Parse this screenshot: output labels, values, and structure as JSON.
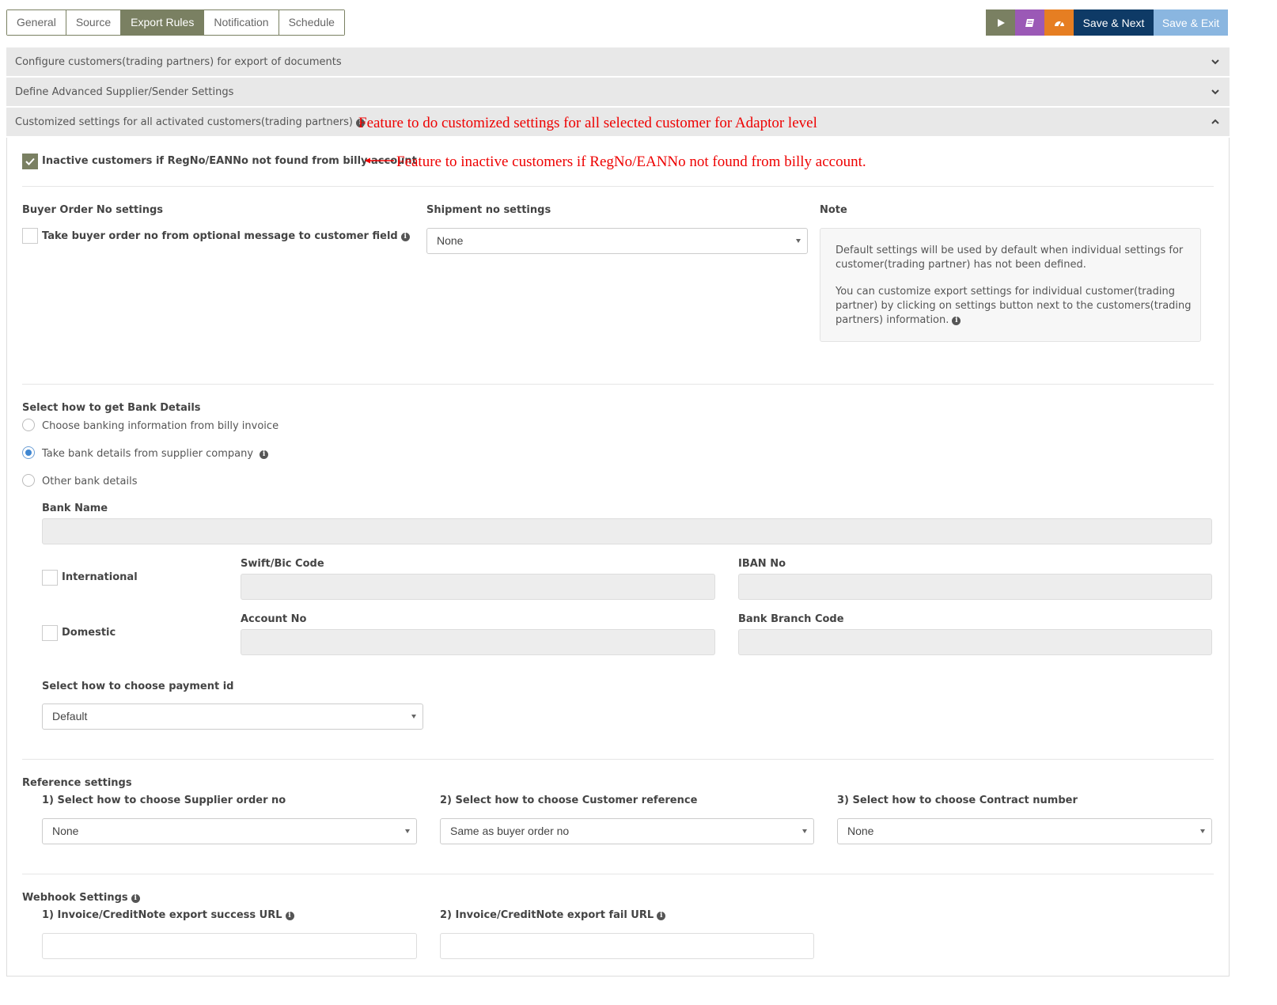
{
  "tabs": [
    {
      "label": "General",
      "active": false
    },
    {
      "label": "Source",
      "active": false
    },
    {
      "label": "Export Rules",
      "active": true
    },
    {
      "label": "Notification",
      "active": false
    },
    {
      "label": "Schedule",
      "active": false
    }
  ],
  "toolbar": {
    "play_icon": "play-icon",
    "book_icon": "book-icon",
    "dashboard_icon": "dashboard-icon",
    "save_next_label": "Save & Next",
    "save_exit_label": "Save & Exit",
    "colors": {
      "play": "#7a8062",
      "book": "#9b59b6",
      "dashboard": "#e67e22",
      "save_next": "#0e3a66",
      "save_exit": "#8ab6e0"
    }
  },
  "accordions": [
    {
      "title": "Configure customers(trading partners) for export of documents",
      "expanded": false
    },
    {
      "title": "Define Advanced Supplier/Sender Settings",
      "expanded": false
    },
    {
      "title": "Customized settings for all activated customers(trading partners)",
      "expanded": true
    }
  ],
  "annotations": {
    "adaptor": "Feature to do customized settings for all selected customer for Adaptor level",
    "inactive": "Feature to inactive customers if RegNo/EANNo not found from billy account."
  },
  "inactive_customers": {
    "label": "Inactive customers if RegNo/EANNo not found from billy account",
    "checked": true
  },
  "buyer_order": {
    "heading": "Buyer Order No settings",
    "checkbox_label": "Take buyer order no from optional message to customer field",
    "checked": false
  },
  "shipment": {
    "heading": "Shipment no settings",
    "selected": "None"
  },
  "note": {
    "heading": "Note",
    "para1": "Default settings will be used by default when individual settings for customer(trading partner) has not been defined.",
    "para2": "You can customize export settings for individual customer(trading partner) by clicking on settings button next to the customers(trading partners) information."
  },
  "bank": {
    "heading": "Select how to get Bank Details",
    "options": [
      {
        "label": "Choose banking information from billy invoice",
        "selected": false
      },
      {
        "label": "Take bank details from supplier company",
        "selected": true
      },
      {
        "label": "Other bank details",
        "selected": false
      }
    ],
    "bank_name_label": "Bank Name",
    "bank_name_value": "",
    "international_label": "International",
    "domestic_label": "Domestic",
    "swift_label": "Swift/Bic Code",
    "swift_value": "",
    "iban_label": "IBAN No",
    "iban_value": "",
    "account_label": "Account No",
    "account_value": "",
    "branch_label": "Bank Branch Code",
    "branch_value": "",
    "payment_id_label": "Select how to choose payment id",
    "payment_id_selected": "Default"
  },
  "reference": {
    "heading": "Reference settings",
    "supplier_label": "1) Select how to choose Supplier order no",
    "supplier_selected": "None",
    "customer_label": "2) Select how to choose Customer reference",
    "customer_selected": "Same as buyer order no",
    "contract_label": "3) Select how to choose Contract number",
    "contract_selected": "None"
  },
  "webhook": {
    "heading": "Webhook Settings",
    "success_label": "1) Invoice/CreditNote export success URL",
    "success_value": "",
    "fail_label": "2) Invoice/CreditNote export fail URL",
    "fail_value": ""
  }
}
